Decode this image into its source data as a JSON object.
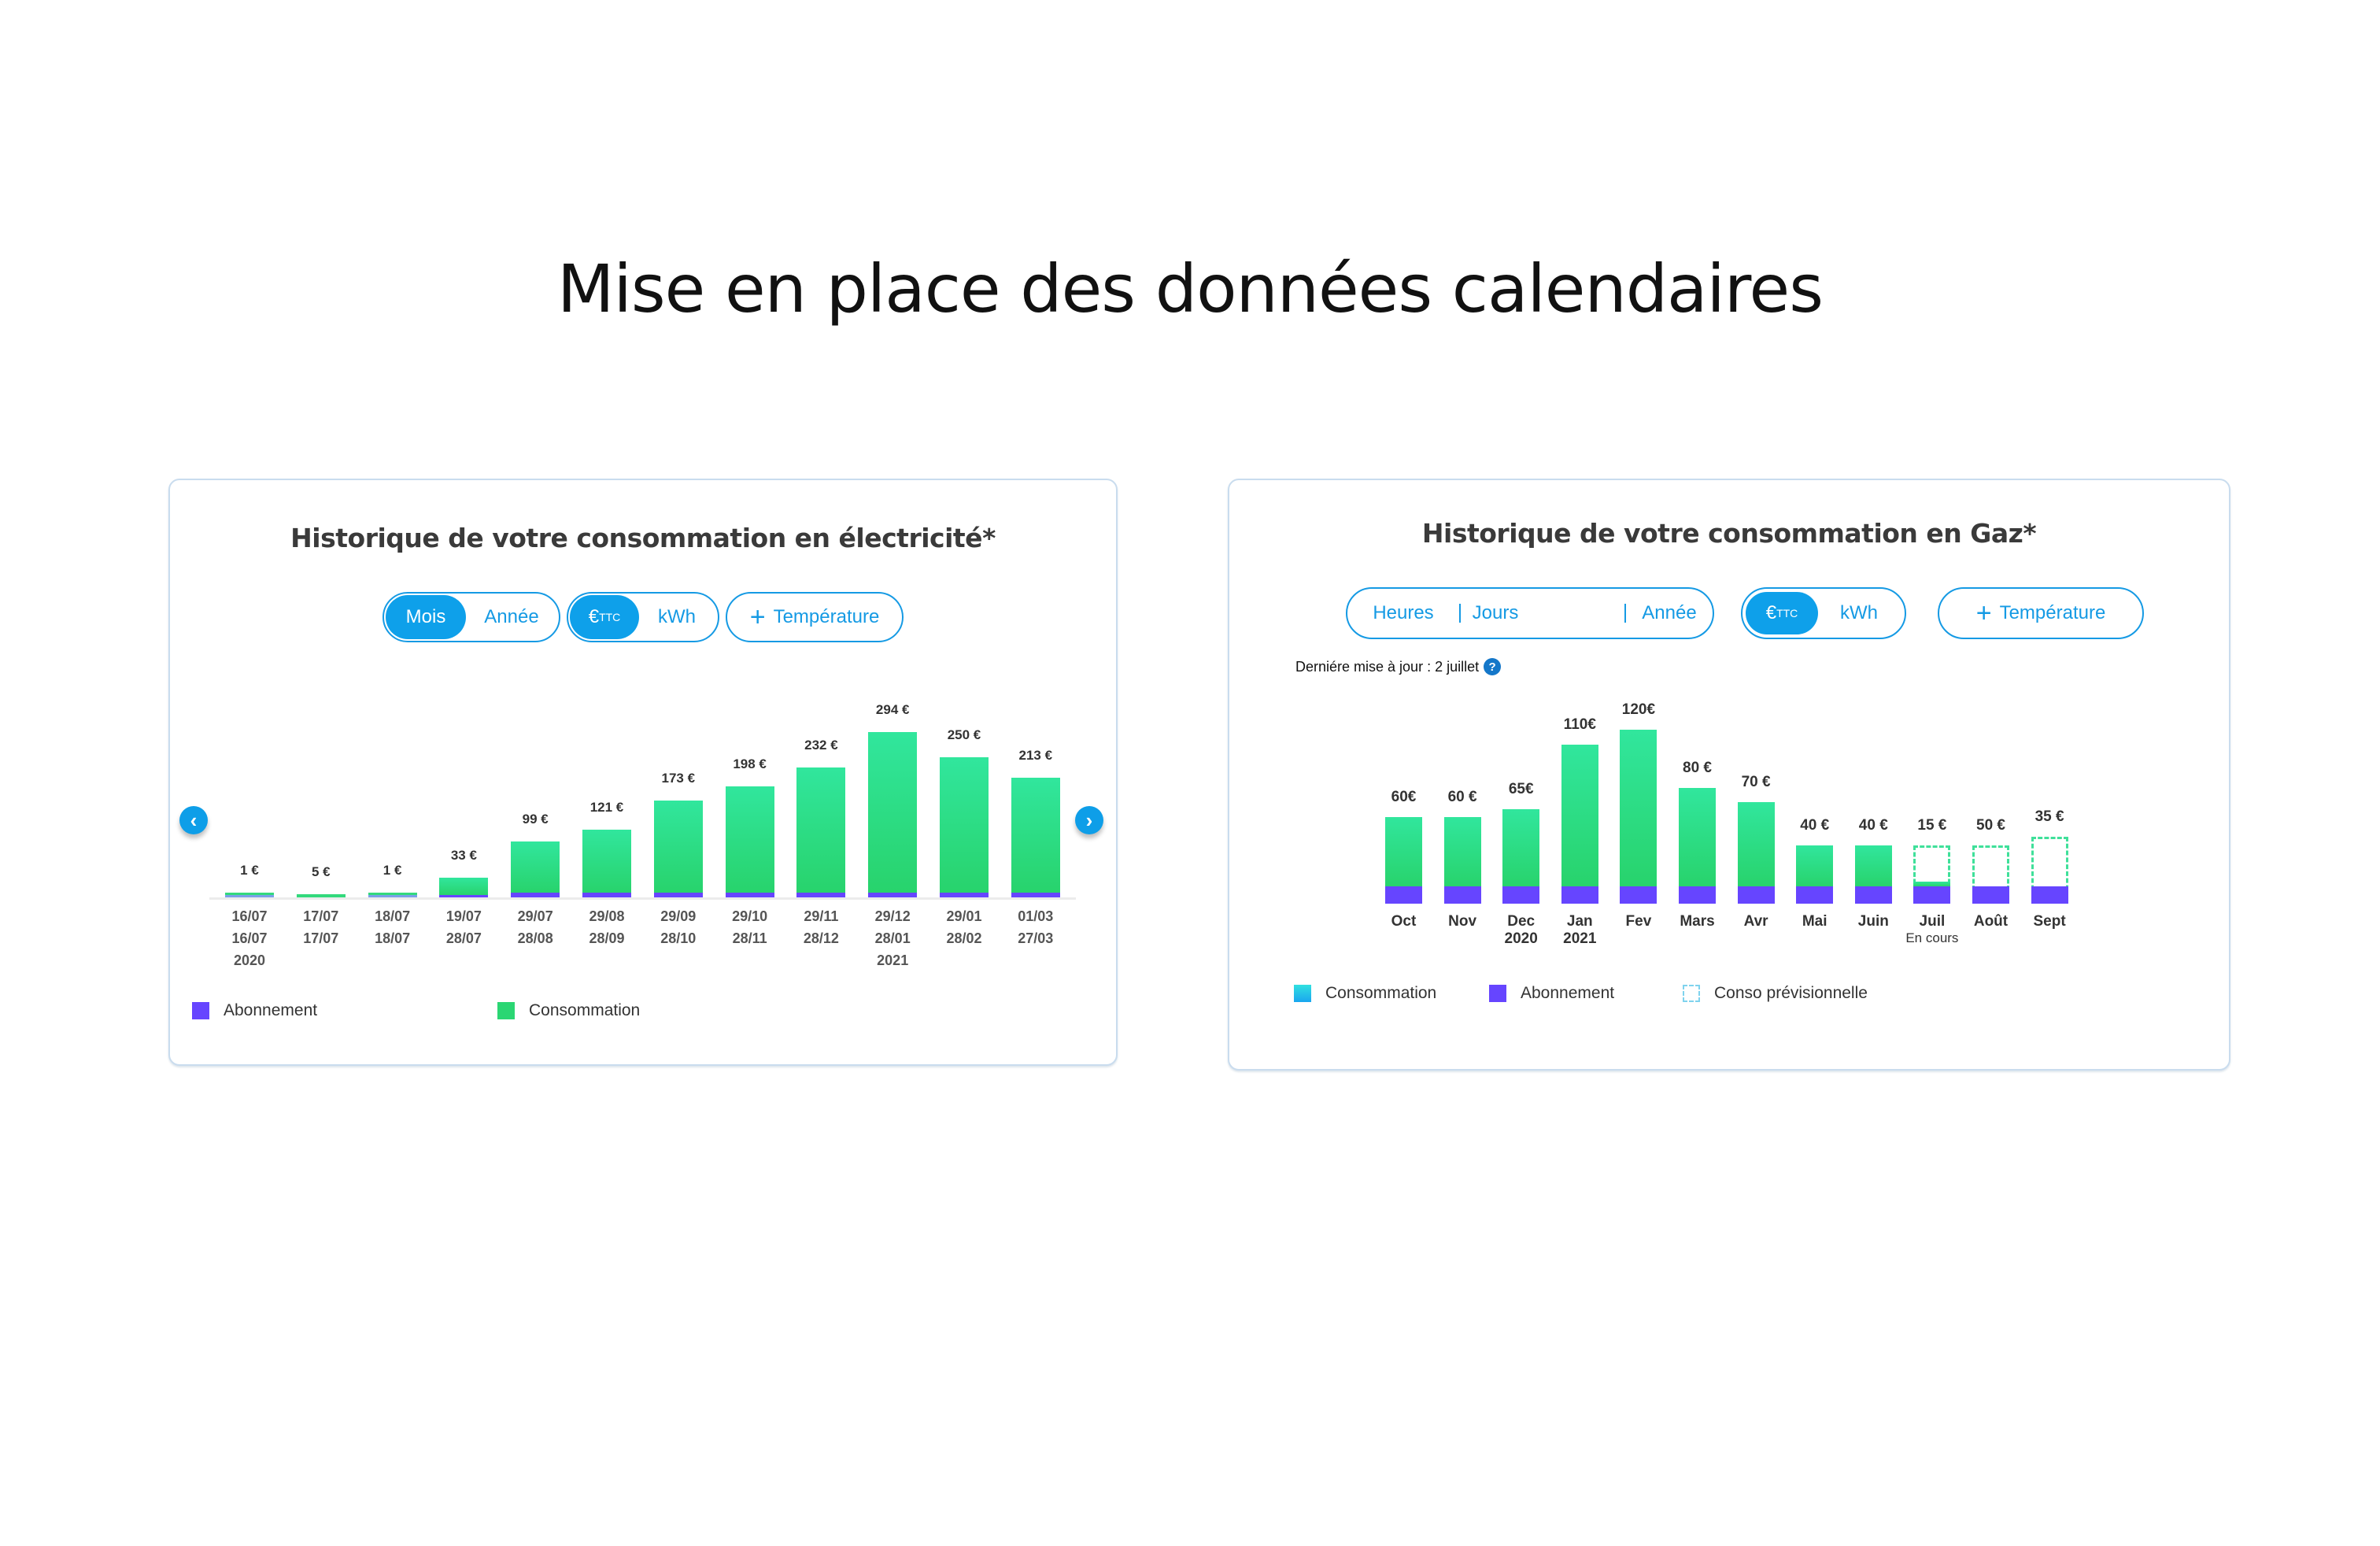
{
  "page": {
    "title": "Mise en place des données calendaires"
  },
  "electricity": {
    "title": "Historique de votre consommation en électricité*",
    "period_toggle": {
      "options": [
        "Mois",
        "Année"
      ],
      "selected": "Mois"
    },
    "unit_toggle": {
      "options": [
        {
          "label": "€",
          "sup": "TTC"
        },
        {
          "label": "kWh",
          "sup": ""
        }
      ],
      "selected": "€TTC"
    },
    "temperature_button": {
      "icon": "plus-icon",
      "label": "Température"
    },
    "prev_icon": "‹",
    "next_icon": "›",
    "legend": [
      {
        "label": "Abonnement",
        "color": "#6645ff"
      },
      {
        "label": "Consommation",
        "color": "#2bd673"
      }
    ]
  },
  "gas": {
    "title": "Historique de votre consommation en Gaz*",
    "period_toggle": {
      "options": [
        "Heures",
        "Jours",
        "Année"
      ]
    },
    "unit_toggle": {
      "options": [
        {
          "label": "€",
          "sup": "TTC"
        },
        {
          "label": "kWh",
          "sup": ""
        }
      ],
      "selected": "€TTC"
    },
    "temperature_button": {
      "icon": "plus-icon",
      "label": "Température"
    },
    "last_update": "Derniére mise à jour : 2 juillet",
    "help_icon": "?",
    "legend": [
      {
        "label": "Consommation",
        "color": "#1fb4e8"
      },
      {
        "label": "Abonnement",
        "color": "#6645ff"
      },
      {
        "label": "Conso prévisionnelle",
        "color": "#7fd3ee"
      }
    ]
  },
  "colors": {
    "accent": "#0ea0ea",
    "consommation_top": "#31e69d",
    "consommation_bottom": "#28d36c",
    "abonnement": "#6645ff",
    "forecast_border": "#3fe09a"
  },
  "chart_data": [
    {
      "type": "bar",
      "title": "Historique de votre consommation en électricité*",
      "stacked": true,
      "categories": [
        [
          "16/07",
          "16/07",
          "2020"
        ],
        [
          "17/07",
          "17/07"
        ],
        [
          "18/07",
          "18/07"
        ],
        [
          "19/07",
          "28/07"
        ],
        [
          "29/07",
          "28/08"
        ],
        [
          "29/08",
          "28/09"
        ],
        [
          "29/09",
          "28/10"
        ],
        [
          "29/10",
          "28/11"
        ],
        [
          "29/11",
          "28/12"
        ],
        [
          "29/12",
          "28/01",
          "2021"
        ],
        [
          "29/01",
          "28/02"
        ],
        [
          "01/03",
          "27/03"
        ]
      ],
      "totals": [
        1,
        5,
        1,
        33,
        99,
        121,
        173,
        198,
        232,
        294,
        250,
        213
      ],
      "value_labels": [
        "1 €",
        "5 €",
        "1 €",
        "33 €",
        "99 €",
        "121 €",
        "173 €",
        "198 €",
        "232 €",
        "294 €",
        "250 €",
        "213 €"
      ],
      "series": [
        {
          "name": "Abonnement",
          "values": [
            0.5,
            0,
            0.5,
            2,
            9,
            9,
            9,
            9,
            9,
            9,
            9,
            9
          ]
        },
        {
          "name": "Consommation",
          "values": [
            0.5,
            5,
            0.5,
            31,
            90,
            112,
            164,
            189,
            223,
            285,
            241,
            204
          ]
        }
      ],
      "ylim": [
        0,
        300
      ],
      "grid": false,
      "legend_position": "bottom-left"
    },
    {
      "type": "bar",
      "title": "Historique de votre consommation en Gaz*",
      "stacked": true,
      "categories": [
        [
          "Oct"
        ],
        [
          "Nov"
        ],
        [
          "Dec",
          "2020"
        ],
        [
          "Jan",
          "2021"
        ],
        [
          "Fev"
        ],
        [
          "Mars"
        ],
        [
          "Avr"
        ],
        [
          "Mai"
        ],
        [
          "Juin"
        ],
        [
          "Juil",
          "En cours"
        ],
        [
          "Août"
        ],
        [
          "Sept"
        ]
      ],
      "totals": [
        60,
        60,
        65,
        110,
        120,
        80,
        70,
        40,
        40,
        15,
        50,
        35
      ],
      "value_labels": [
        "60€",
        "60 €",
        "65€",
        "110€",
        "120€",
        "80 €",
        "70 €",
        "40 €",
        "40 €",
        "15 €",
        "50 €",
        "35 €"
      ],
      "series": [
        {
          "name": "Abonnement",
          "values": [
            12,
            12,
            12,
            12,
            12,
            12,
            12,
            12,
            12,
            12,
            12,
            12
          ]
        },
        {
          "name": "Consommation",
          "values": [
            48,
            48,
            53,
            98,
            108,
            68,
            58,
            28,
            28,
            3,
            0,
            0
          ]
        },
        {
          "name": "Conso prévisionnelle",
          "values": [
            0,
            0,
            0,
            0,
            0,
            0,
            0,
            0,
            0,
            40,
            40,
            46
          ]
        }
      ],
      "ylim": [
        0,
        125
      ],
      "grid": false,
      "legend_position": "bottom-left"
    }
  ]
}
